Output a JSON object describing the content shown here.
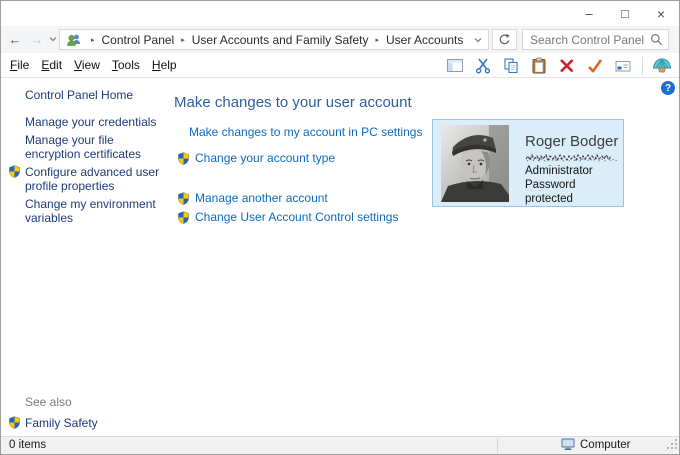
{
  "window": {
    "title": "",
    "controls": {
      "minimize": "–",
      "maximize": "□",
      "close": "×"
    }
  },
  "address_bar": {
    "breadcrumb": {
      "icon": "user-accounts-icon",
      "separator": "▸",
      "items": [
        "Control Panel",
        "User Accounts and Family Safety",
        "User Accounts"
      ]
    },
    "refresh_icon": "refresh-icon",
    "search": {
      "placeholder": "Search Control Panel",
      "icon": "search-icon"
    }
  },
  "menu_bar": {
    "items": [
      "File",
      "Edit",
      "View",
      "Tools",
      "Help"
    ]
  },
  "toolbar": {
    "icons": [
      "organize-panel-icon",
      "cut-icon",
      "copy-icon",
      "paste-icon",
      "delete-icon",
      "check-icon",
      "mail-card-icon",
      "shell-icon"
    ]
  },
  "help_button": {
    "label": "?"
  },
  "sidebar": {
    "home_label": "Control Panel Home",
    "tasks": [
      {
        "label": "Manage your credentials",
        "shield": false
      },
      {
        "label": "Manage your file encryption certificates",
        "shield": false
      },
      {
        "label": "Configure advanced user profile properties",
        "shield": true
      },
      {
        "label": "Change my environment variables",
        "shield": false
      }
    ],
    "see_also": {
      "label": "See also",
      "items": [
        {
          "label": "Family Safety",
          "shield": true
        }
      ]
    }
  },
  "main": {
    "heading": "Make changes to your user account",
    "links": [
      {
        "label": "Make changes to my account in PC settings",
        "shield": false
      },
      {
        "label": "Change your account type",
        "shield": true
      },
      {
        "label": "Manage another account",
        "shield": true
      },
      {
        "label": "Change User Account Control settings",
        "shield": true
      }
    ],
    "account_card": {
      "name": "Roger Bodger",
      "email_redacted_scribble": true,
      "role": "Administrator",
      "password_status": "Password protected",
      "photo": "black-and-white portrait of man in military cap"
    }
  },
  "status_bar": {
    "items_count": "0 items",
    "location": "Computer"
  },
  "colors": {
    "task_link_blue": "#0b6cc1",
    "sidebar_link_navy": "#1e3b77",
    "heading_blue": "#2f5e9e",
    "card_bg": "#daedf9",
    "card_border": "#94c7e8",
    "help_badge_blue": "#1c70c8",
    "delete_red": "#cf1f1f",
    "check_orange": "#e2651f",
    "statusbar_bg": "#f1f1f1"
  }
}
